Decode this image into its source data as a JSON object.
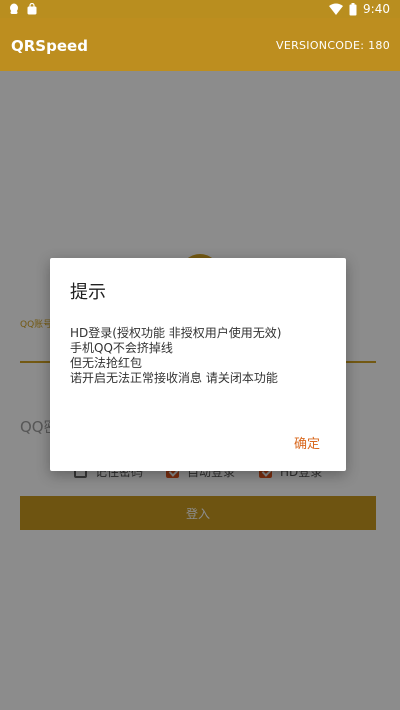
{
  "status_bar": {
    "time": "9:40",
    "left_icons": [
      "qq-notification-icon",
      "shopping-bag-icon"
    ],
    "right_icons": [
      "wifi-icon",
      "battery-icon"
    ]
  },
  "app_bar": {
    "title": "QRSpeed",
    "version": "VERSIONCODE: 180"
  },
  "login_form": {
    "account_label": "QQ账号",
    "password_placeholder": "QQ密码",
    "options": [
      {
        "label": "记住密码",
        "checked": false
      },
      {
        "label": "自动登录",
        "checked": true
      },
      {
        "label": "HD登录",
        "checked": true
      }
    ],
    "login_button": "登入"
  },
  "dialog": {
    "title": "提示",
    "lines": [
      "HD登录(授权功能 非授权用户使用无效)",
      "手机QQ不会挤掉线",
      "但无法抢红包",
      "诺开启无法正常接收消息 请关闭本功能"
    ],
    "ok_button": "确定"
  },
  "colors": {
    "primary": "#bd8e1f",
    "accent": "#d9681e",
    "checkbox": "#e0561e"
  }
}
